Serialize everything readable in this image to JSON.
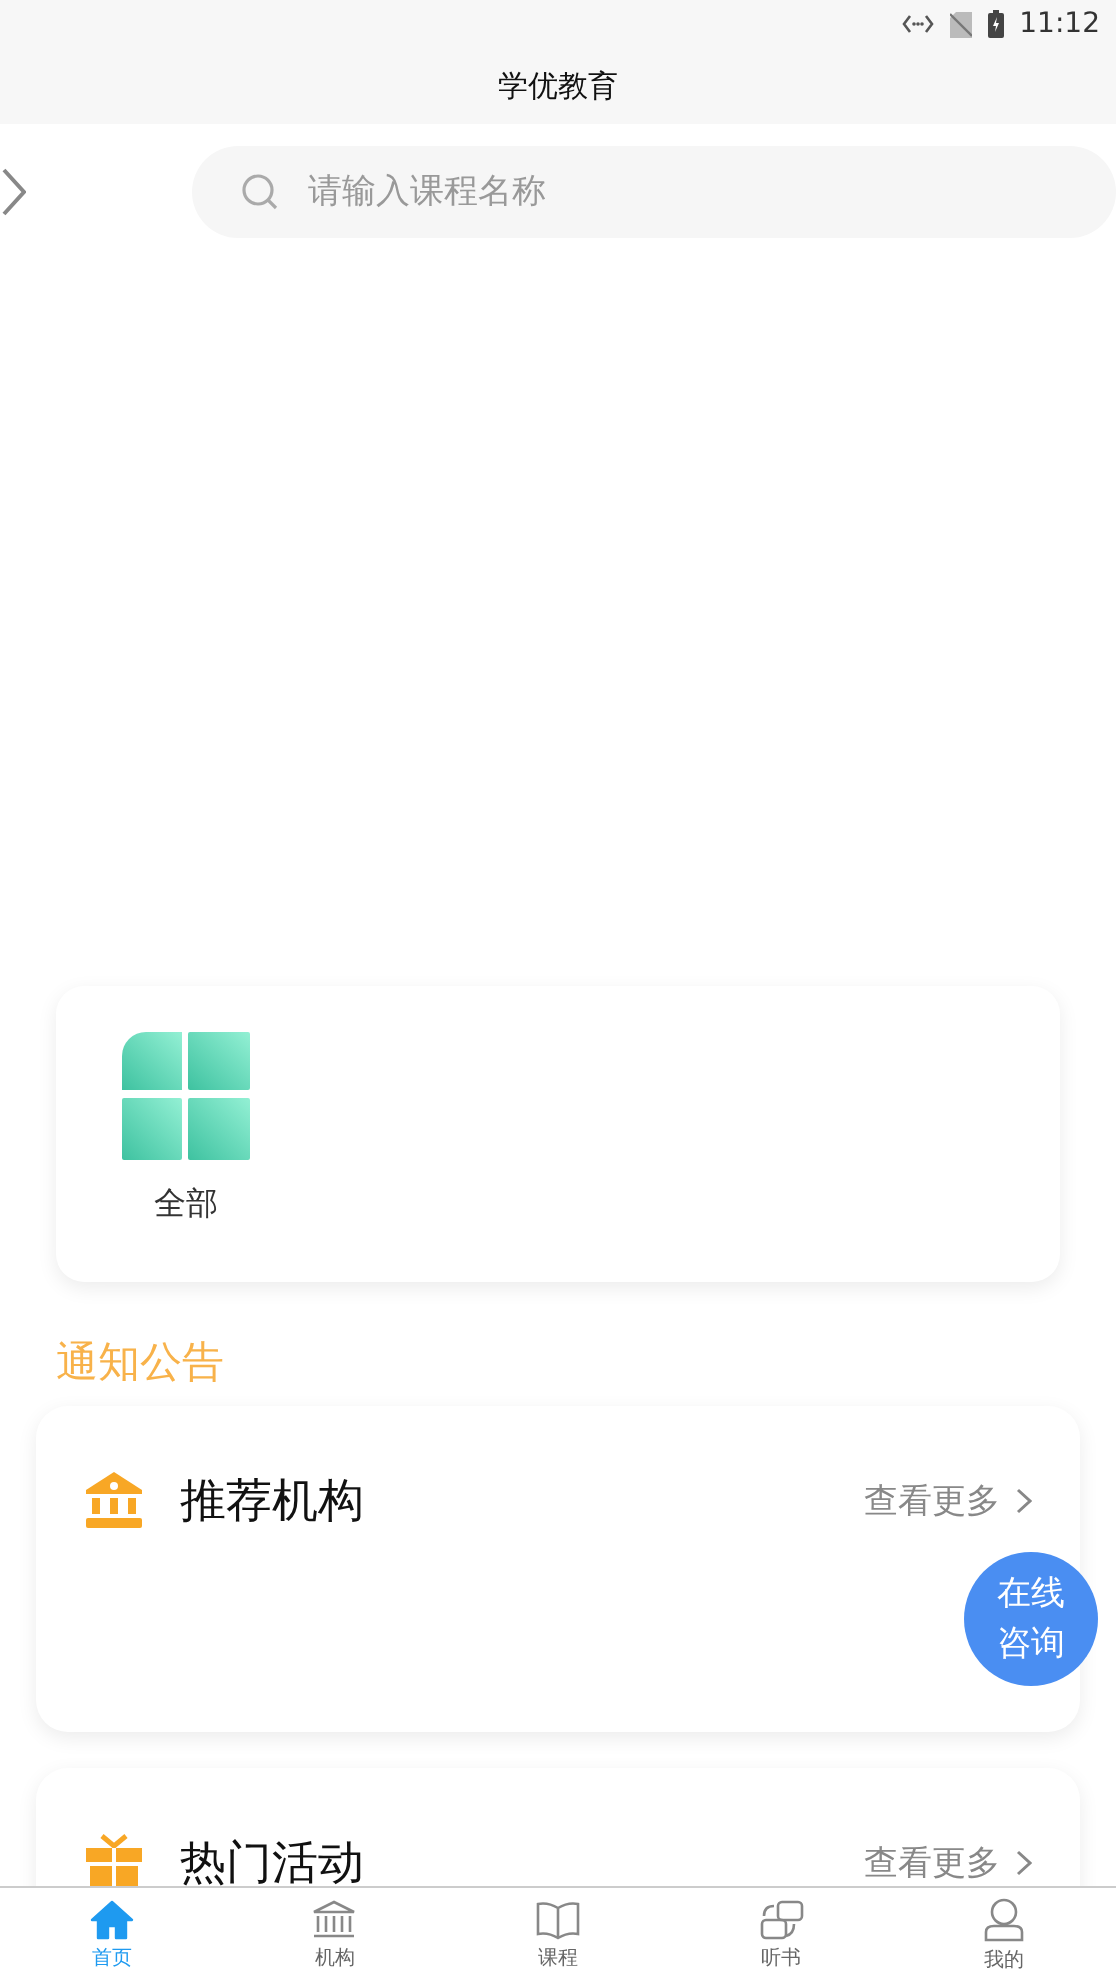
{
  "status_bar": {
    "time": "11:12"
  },
  "header": {
    "title": "学优教育"
  },
  "search": {
    "placeholder": "请输入课程名称"
  },
  "categories": [
    {
      "label": "全部"
    }
  ],
  "notice": {
    "title": "通知公告"
  },
  "sections": [
    {
      "kind": "institution",
      "title": "推荐机构",
      "more": "查看更多"
    },
    {
      "kind": "activity",
      "title": "热门活动",
      "more": "查看更多"
    }
  ],
  "consult_button": {
    "lines": [
      "在线",
      "咨询"
    ]
  },
  "tabs": [
    {
      "kind": "home",
      "label": "首页",
      "selected": true
    },
    {
      "kind": "institution",
      "label": "机构",
      "selected": false
    },
    {
      "kind": "course",
      "label": "课程",
      "selected": false
    },
    {
      "kind": "audiobook",
      "label": "听书",
      "selected": false
    },
    {
      "kind": "profile",
      "label": "我的",
      "selected": false
    }
  ]
}
